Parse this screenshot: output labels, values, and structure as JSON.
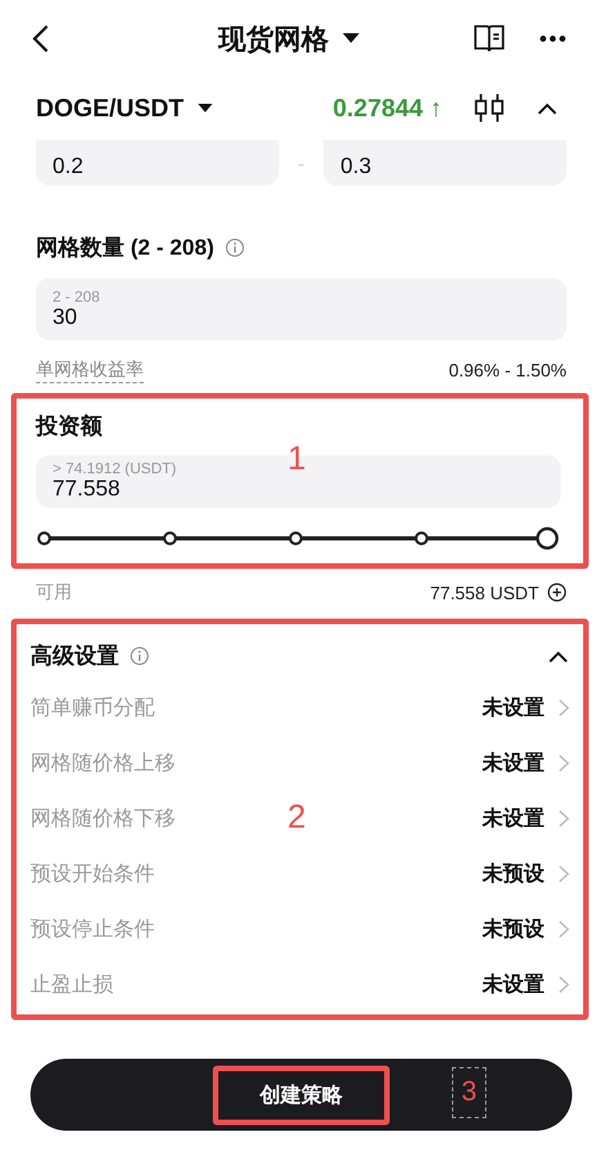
{
  "header": {
    "title": "现货网格"
  },
  "pair": {
    "symbol": "DOGE/USDT",
    "price": "0.27844",
    "arrow": "↑"
  },
  "range": {
    "low": "0.2",
    "separator": "-",
    "high": "0.3"
  },
  "grid_count": {
    "label": "网格数量 (2 - 208)",
    "hint": "2 - 208",
    "value": "30"
  },
  "yield": {
    "label": "单网格收益率",
    "value": "0.96% - 1.50%"
  },
  "investment": {
    "label": "投资额",
    "hint": "> 74.1912 (USDT)",
    "value": "77.558",
    "level": 1,
    "annotation": "1"
  },
  "available": {
    "label": "可用",
    "value": "77.558 USDT"
  },
  "advanced": {
    "title": "高级设置",
    "expanded": true,
    "annotation": "2",
    "rows": [
      {
        "label": "简单赚币分配",
        "value": "未设置"
      },
      {
        "label": "网格随价格上移",
        "value": "未设置"
      },
      {
        "label": "网格随价格下移",
        "value": "未设置"
      },
      {
        "label": "预设开始条件",
        "value": "未预设"
      },
      {
        "label": "预设停止条件",
        "value": "未预设"
      },
      {
        "label": "止盈止损",
        "value": "未设置"
      }
    ]
  },
  "submit": {
    "label": "创建策略",
    "annotation": "3"
  }
}
